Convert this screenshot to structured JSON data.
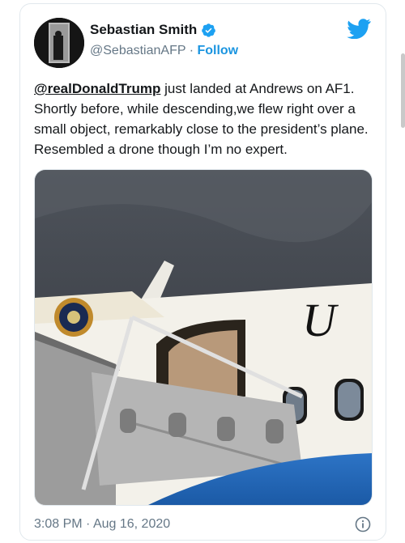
{
  "author": {
    "name": "Sebastian Smith",
    "handle": "@SebastianAFP",
    "separator": "·",
    "follow_label": "Follow",
    "verified_icon": "verified-badge-icon"
  },
  "tweet": {
    "mention": "@realDonaldTrump",
    "text": " just landed at Andrews on AF1. Shortly before, while descending,we flew right over a small object, remarkably close to the president’s plane. Resembled a drone though I’m no expert."
  },
  "photo": {
    "fuselage_letter": "U"
  },
  "footer": {
    "time": "3:08 PM",
    "separator": "·",
    "date": "Aug 16, 2020"
  },
  "colors": {
    "brand": "#1da1f2",
    "link": "#1b95e0",
    "text": "#14171a",
    "muted": "#657786",
    "border": "#e1e8ed"
  },
  "icons": [
    "twitter-bird-icon",
    "verified-badge-icon",
    "info-icon"
  ]
}
